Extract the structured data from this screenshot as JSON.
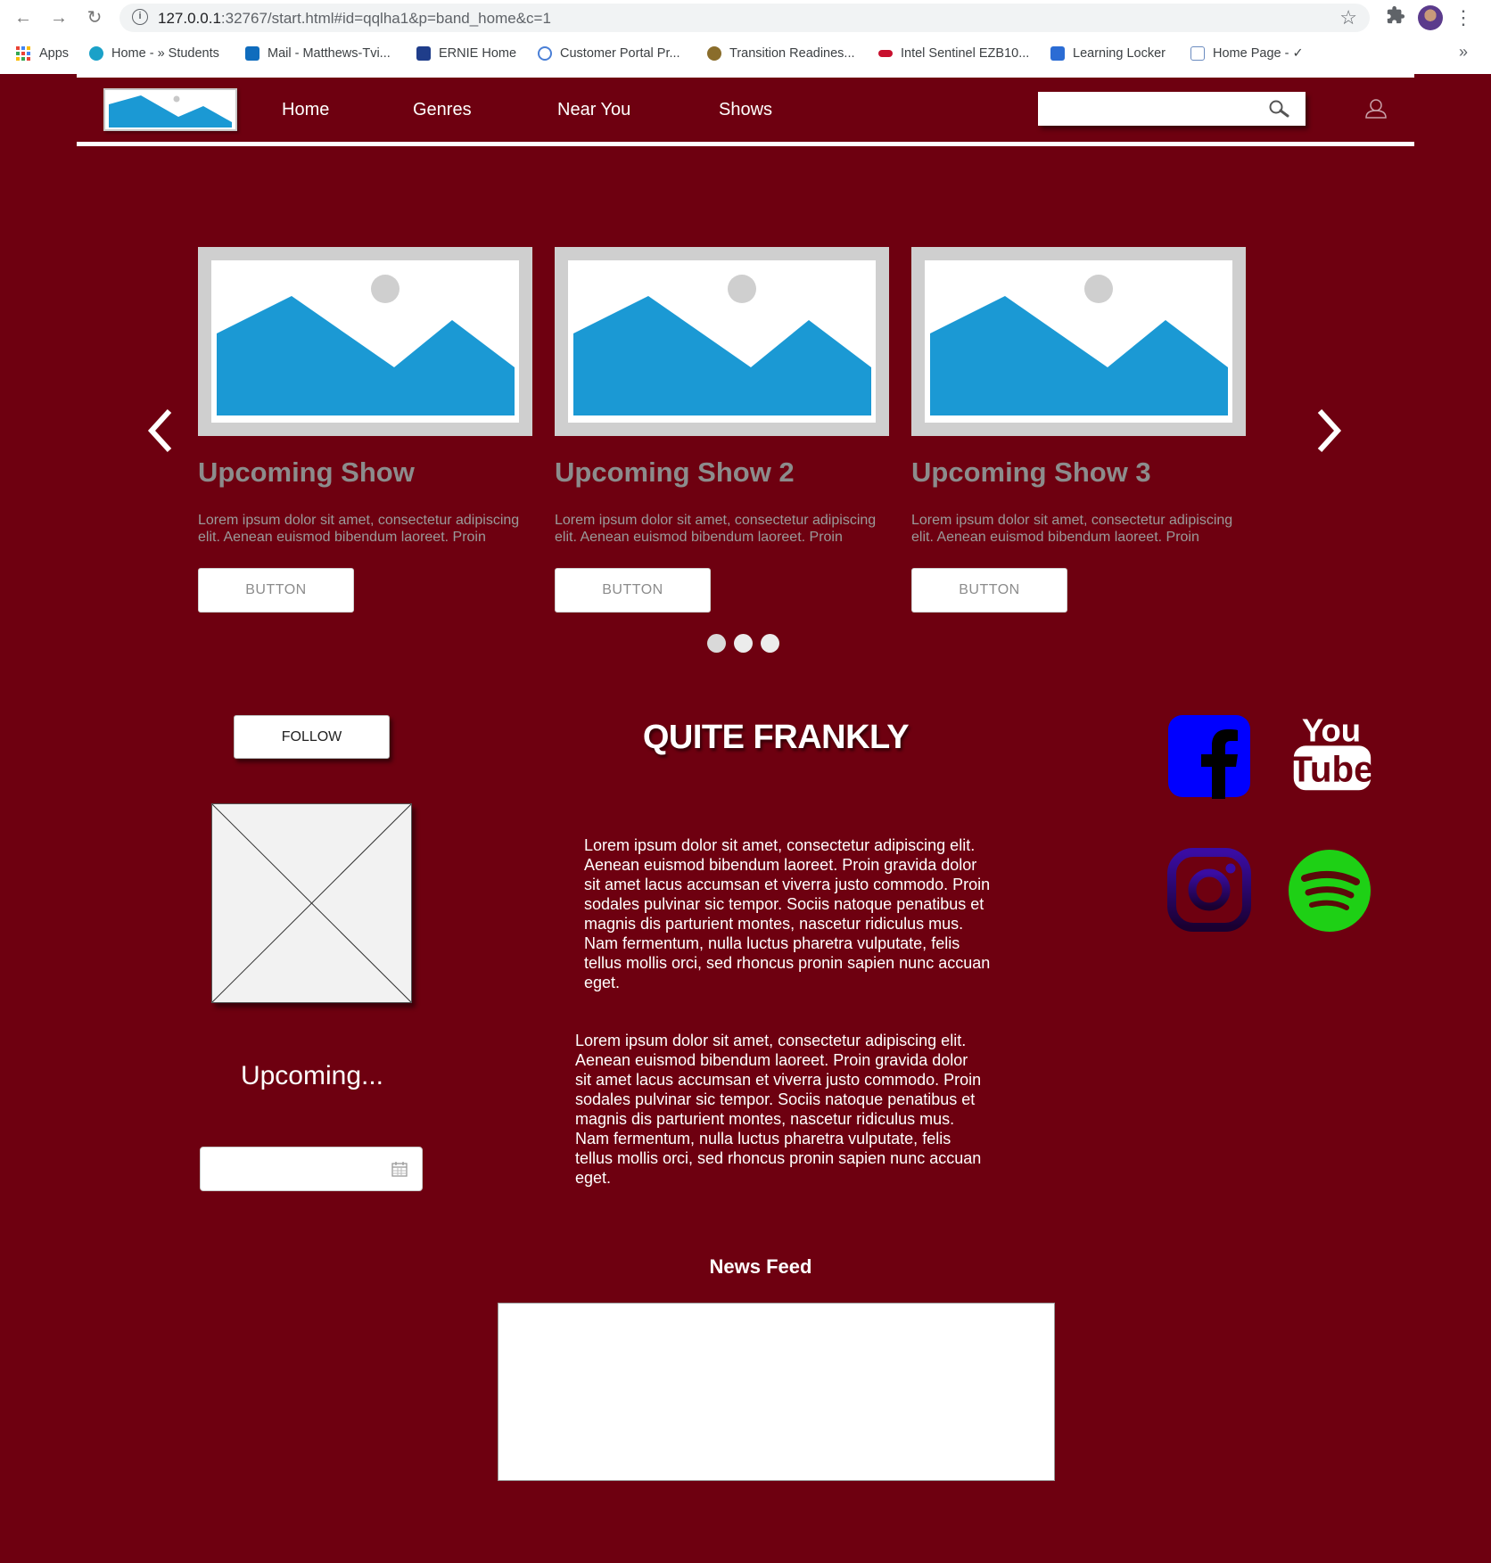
{
  "browser": {
    "url_host": "127.0.0.1",
    "url_rest": ":32767/start.html#id=qqlha1&p=band_home&c=1",
    "bookmarks": [
      {
        "label": "Apps",
        "icon": "apps-grid-icon"
      },
      {
        "label": "Home - » Students",
        "icon": "globe-icon",
        "color": "#1aa1c8"
      },
      {
        "label": "Mail - Matthews-Tvi...",
        "icon": "outlook-icon",
        "color": "#0f6cbd"
      },
      {
        "label": "ERNIE Home",
        "icon": "ernie-icon",
        "color": "#1f3d8a"
      },
      {
        "label": "Customer Portal Pr...",
        "icon": "portal-icon",
        "color": "#4a7fd6"
      },
      {
        "label": "Transition Readines...",
        "icon": "emblem-icon",
        "color": "#8a6d2b"
      },
      {
        "label": "Intel Sentinel EZB10...",
        "icon": "intel-icon",
        "color": "#c8102e"
      },
      {
        "label": "Learning Locker",
        "icon": "ml-icon",
        "color": "#2b6cd4"
      },
      {
        "label": "Home Page - ✓",
        "icon": "doc-icon",
        "color": "#6b8bbf"
      }
    ]
  },
  "header": {
    "nav": [
      "Home",
      "Genres",
      "Near You",
      "Shows"
    ],
    "search_placeholder": ""
  },
  "carousel": {
    "cards": [
      {
        "title": "Upcoming Show",
        "description": "Lorem ipsum dolor sit amet, consectetur adipiscing elit. Aenean euismod bibendum laoreet. Proin",
        "button": "BUTTON"
      },
      {
        "title": "Upcoming Show 2",
        "description": "Lorem ipsum dolor sit amet, consectetur adipiscing elit. Aenean euismod bibendum laoreet. Proin",
        "button": "BUTTON"
      },
      {
        "title": "Upcoming Show 3",
        "description": "Lorem ipsum dolor sit amet, consectetur adipiscing elit. Aenean euismod bibendum laoreet. Proin",
        "button": "BUTTON"
      }
    ],
    "dot_count": 3,
    "dot_color": "#d9d9d9"
  },
  "sidebar": {
    "follow_label": "FOLLOW",
    "upcoming_label": "Upcoming...",
    "date_value": ""
  },
  "main": {
    "band_name": "QUITE FRANKLY",
    "paragraphs": [
      "Lorem ipsum dolor sit amet, consectetur adipiscing elit. Aenean euismod bibendum laoreet. Proin gravida dolor sit amet lacus accumsan et viverra justo commodo. Proin sodales pulvinar sic tempor. Sociis natoque penatibus et magnis dis parturient montes, nascetur ridiculus mus. Nam fermentum, nulla luctus pharetra vulputate, felis tellus mollis orci, sed rhoncus pronin sapien nunc accuan eget.",
      "Lorem ipsum dolor sit amet, consectetur adipiscing elit. Aenean euismod bibendum laoreet. Proin gravida dolor sit amet lacus accumsan et viverra justo commodo. Proin sodales pulvinar sic tempor. Sociis natoque penatibus et magnis dis parturient montes, nascetur ridiculus mus. Nam fermentum, nulla luctus pharetra vulputate, felis tellus mollis orci, sed rhoncus pronin sapien nunc accuan eget."
    ]
  },
  "social": {
    "icons": [
      "facebook-icon",
      "youtube-icon",
      "instagram-icon",
      "spotify-icon"
    ],
    "youtube_top": "You",
    "youtube_bottom": "Tube",
    "colors": {
      "facebook": "#0000ff",
      "youtube": "#ffffff",
      "instagram": "#3a0ca3",
      "spotify": "#1ed015"
    }
  },
  "news": {
    "title": "News Feed"
  },
  "theme": {
    "background": "#6e0010",
    "image_blue": "#1b99d4",
    "image_frame": "#cfcfcf"
  }
}
